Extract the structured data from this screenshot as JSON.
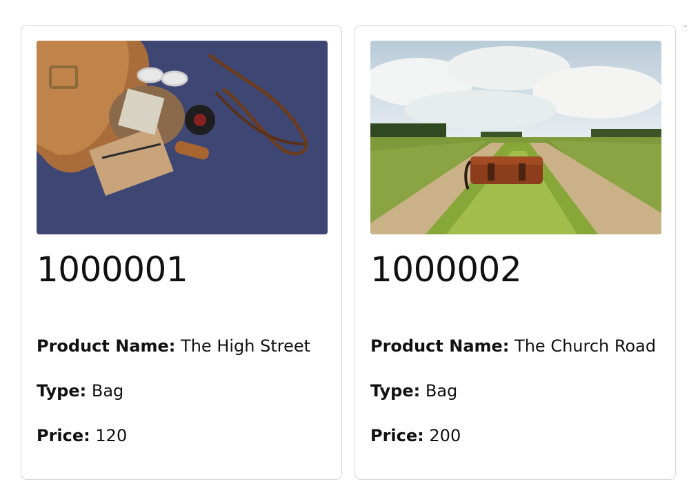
{
  "products": [
    {
      "id": "1000001",
      "image_alt": "leather bag on blue background",
      "fields": {
        "name_label": "Product Name:",
        "name_value": "The High Street",
        "type_label": "Type:",
        "type_value": "Bag",
        "price_label": "Price:",
        "price_value": "120"
      }
    },
    {
      "id": "1000002",
      "image_alt": "brown bag on grassy dirt road",
      "fields": {
        "name_label": "Product Name:",
        "name_value": "The Church Road",
        "type_label": "Type:",
        "type_value": "Bag",
        "price_label": "Price:",
        "price_value": "200"
      }
    }
  ],
  "scrollbar": {
    "up_arrow_icon": "chevron-up-icon",
    "glyph": "˄"
  }
}
